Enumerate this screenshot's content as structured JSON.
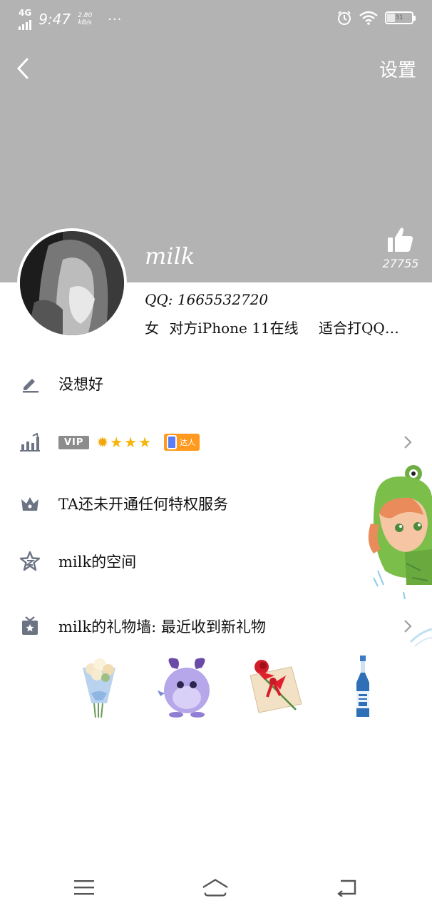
{
  "status_bar": {
    "network": "4G",
    "time": "9:47",
    "speed_value": "2.80",
    "speed_unit": "kB/s",
    "more": "···",
    "battery": "31"
  },
  "header": {
    "settings_label": "设置",
    "background_color": "#b3b3b3"
  },
  "profile": {
    "nickname": "milk",
    "like_count": "27755",
    "qq_line": "QQ: 1665532720",
    "gender": "女",
    "device_status": "对方iPhone 11在线",
    "signature": "适合打QQ…"
  },
  "rows": {
    "signature": "没想好",
    "vip_tag": "VIP",
    "daren_label": "达人",
    "privilege": "TA还未开通任何特权服务",
    "space": "milk的空间",
    "gift_wall": "milk的礼物墙: 最近收到新礼物"
  },
  "gifts": [
    {
      "icon": "flower-bouquet-icon"
    },
    {
      "icon": "purple-monster-icon"
    },
    {
      "icon": "rose-card-icon"
    },
    {
      "icon": "bottle-icon"
    }
  ]
}
